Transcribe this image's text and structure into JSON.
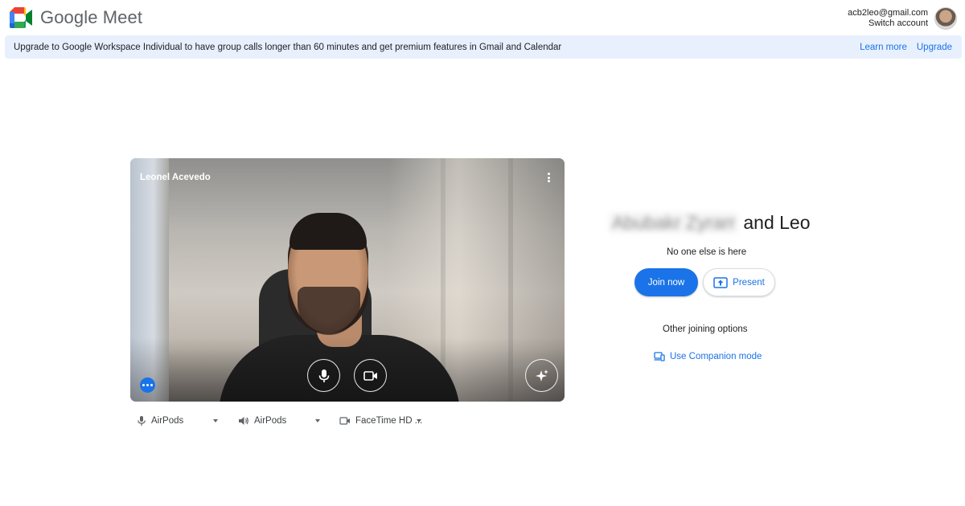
{
  "header": {
    "app_title": "Google Meet",
    "account_email": "acb2leo@gmail.com",
    "switch_account": "Switch account"
  },
  "banner": {
    "text": "Upgrade to Google Workspace Individual to have group calls longer than 60 minutes and get premium features in Gmail and Calendar",
    "learn_more": "Learn more",
    "upgrade": "Upgrade"
  },
  "preview": {
    "participant_name": "Leonel Acevedo",
    "icons": {
      "options": "more-vert-icon",
      "mic": "mic-icon",
      "camera": "videocam-icon",
      "effects": "sparkle-effects-icon",
      "more": "more-horiz-icon"
    }
  },
  "devices": {
    "microphone": "AirPods",
    "speaker": "AirPods",
    "camera": "FaceTime HD ..."
  },
  "join_panel": {
    "meeting_title_blurred": "Abubakr Zyrarr",
    "meeting_title_suffix": "and Leo",
    "status": "No one else is here",
    "join_now": "Join now",
    "present": "Present",
    "other_options": "Other joining options",
    "companion_mode": "Use Companion mode"
  },
  "colors": {
    "accent": "#1a73e8",
    "banner_bg": "#e8f0fe",
    "text": "#202124"
  }
}
